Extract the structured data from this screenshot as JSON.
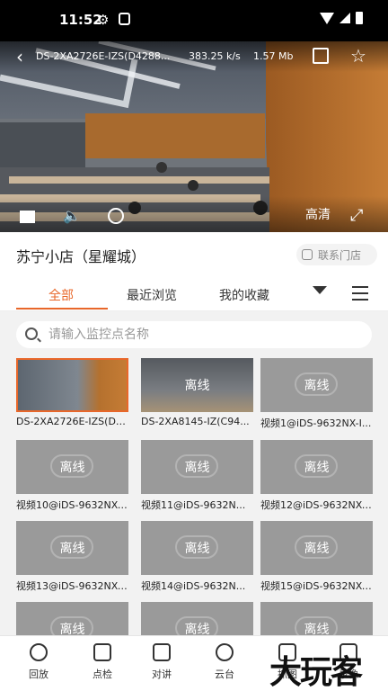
{
  "status": {
    "time": "11:52"
  },
  "player": {
    "camera_title": "DS-2XA2726E-IZS(D4288...",
    "bitrate": "383.25 k/s",
    "data_size": "1.57 Mb",
    "quality_label": "高清"
  },
  "store": {
    "name": "苏宁小店（星耀城）",
    "contact_label": "联系门店"
  },
  "tabs": [
    {
      "label": "全部",
      "active": true
    },
    {
      "label": "最近浏览",
      "active": false
    },
    {
      "label": "我的收藏",
      "active": false
    }
  ],
  "search": {
    "placeholder": "请输入监控点名称"
  },
  "cameras": [
    {
      "name": "DS-2XA2726E-IZS(D4...",
      "status": "",
      "selected": true
    },
    {
      "name": "DS-2XA8145-IZ(C94...",
      "status": "离线",
      "selected": false
    },
    {
      "name": "视频1@iDS-9632NX-I...",
      "status": "离线",
      "selected": false
    },
    {
      "name": "视频10@iDS-9632NX-...",
      "status": "离线",
      "selected": false
    },
    {
      "name": "视频11@iDS-9632N...",
      "status": "离线",
      "selected": false
    },
    {
      "name": "视频12@iDS-9632NX-...",
      "status": "离线",
      "selected": false
    },
    {
      "name": "视频13@iDS-9632NX-...",
      "status": "离线",
      "selected": false
    },
    {
      "name": "视频14@iDS-9632N...",
      "status": "离线",
      "selected": false
    },
    {
      "name": "视频15@iDS-9632NX-...",
      "status": "离线",
      "selected": false
    },
    {
      "name": "",
      "status": "离线",
      "selected": false
    },
    {
      "name": "",
      "status": "离线",
      "selected": false
    },
    {
      "name": "",
      "status": "离线",
      "selected": false
    }
  ],
  "nav": [
    {
      "label": "回放",
      "icon": "playback-icon"
    },
    {
      "label": "点检",
      "icon": "checklist-icon"
    },
    {
      "label": "对讲",
      "icon": "microphone-icon"
    },
    {
      "label": "云台",
      "icon": "ptz-icon"
    },
    {
      "label": "抓图",
      "icon": "snapshot-icon"
    },
    {
      "label": "录像",
      "icon": "record-icon"
    }
  ],
  "watermark": "大玩客",
  "colors": {
    "accent": "#e8672a",
    "offline_tile": "#9a9a9a"
  }
}
